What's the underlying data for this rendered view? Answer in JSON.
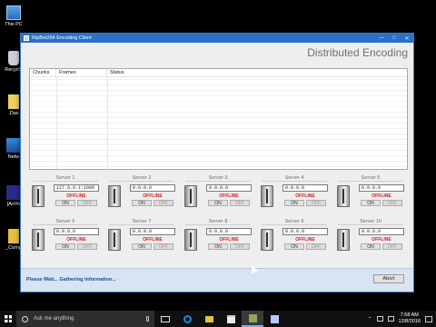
{
  "desktop": {
    "icons": [
      {
        "label": "This PC",
        "glyph": "computer-icon"
      },
      {
        "label": "Recycle",
        "glyph": "recycle-bin-icon"
      },
      {
        "label": ".Dav",
        "glyph": "document-icon"
      },
      {
        "label": "Netw",
        "glyph": "network-icon"
      },
      {
        "label": "[AnYo",
        "glyph": "app-icon"
      },
      {
        "label": "_Comp",
        "glyph": "folder-icon"
      }
    ]
  },
  "window": {
    "title": "RipBot264 Encoding Client",
    "controls": {
      "minimize": "—",
      "maximize": "□",
      "close": "✕"
    },
    "header": "Distributed Encoding",
    "list": {
      "columns": [
        "Chunks",
        "Frames",
        "Status"
      ]
    },
    "servers": [
      {
        "title": "Server 1",
        "ip": "127.0.0.1:1000",
        "status": "OFFLINE",
        "on": "ON",
        "off": "OFF"
      },
      {
        "title": "Server 2",
        "ip": "0.0.0.0",
        "status": "OFFLINE",
        "on": "ON",
        "off": "OFF"
      },
      {
        "title": "Server 3",
        "ip": "0.0.0.0",
        "status": "OFFLINE",
        "on": "ON",
        "off": "OFF"
      },
      {
        "title": "Server 4",
        "ip": "0.0.0.0",
        "status": "OFFLINE",
        "on": "ON",
        "off": "OFF"
      },
      {
        "title": "Server 5",
        "ip": "0.0.0.0",
        "status": "OFFLINE",
        "on": "ON",
        "off": "OFF"
      },
      {
        "title": "Server 6",
        "ip": "0.0.0.0",
        "status": "OFFLINE",
        "on": "ON",
        "off": "OFF"
      },
      {
        "title": "Server 7",
        "ip": "0.0.0.0",
        "status": "OFFLINE",
        "on": "ON",
        "off": "OFF"
      },
      {
        "title": "Server 8",
        "ip": "0.0.0.0",
        "status": "OFFLINE",
        "on": "ON",
        "off": "OFF"
      },
      {
        "title": "Server 9",
        "ip": "0.0.0.0",
        "status": "OFFLINE",
        "on": "ON",
        "off": "OFF"
      },
      {
        "title": "Server 10",
        "ip": "0.0.0.0",
        "status": "OFFLINE",
        "on": "ON",
        "off": "OFF"
      }
    ],
    "statusbar": {
      "message": "Please Wait... Gathering information...",
      "abort_label": "Abort"
    }
  },
  "taskbar": {
    "search_placeholder": "Ask me anything",
    "tray_arrow": "⌃",
    "time": "7:58 AM",
    "date": "12/8/2016"
  },
  "colors": {
    "titlebar": "#2b70c9",
    "status_offline": "#d02020",
    "statusbar_bg": "#d8e4f4"
  }
}
